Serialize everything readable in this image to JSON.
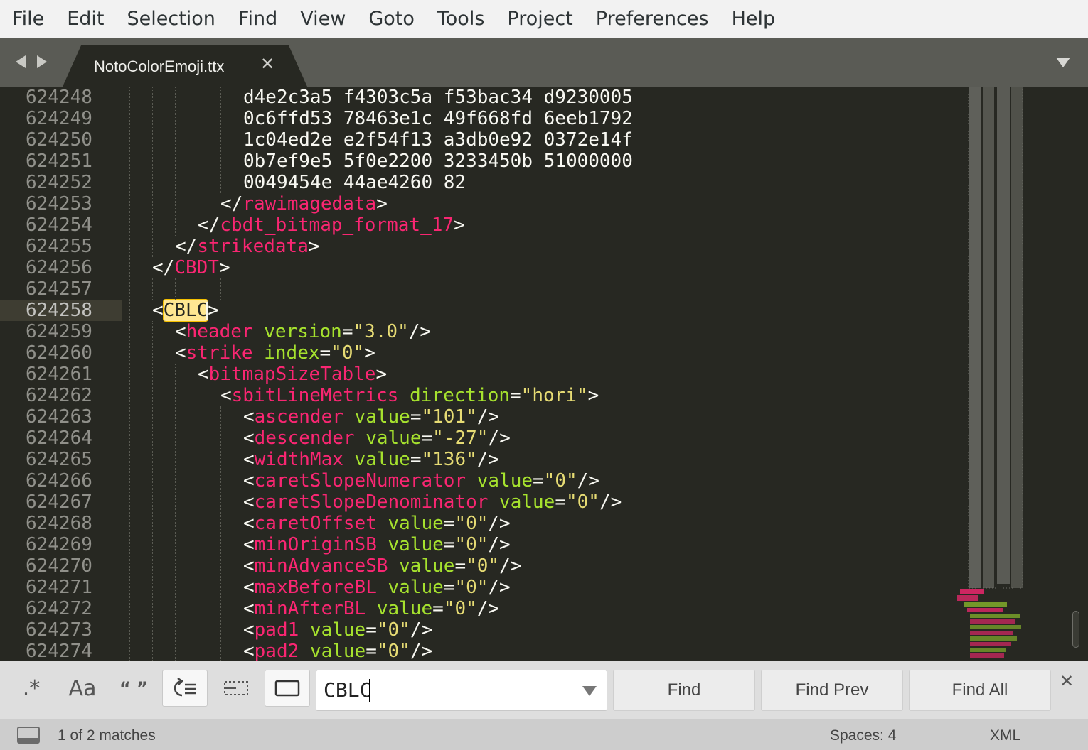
{
  "menubar": {
    "items": [
      "File",
      "Edit",
      "Selection",
      "Find",
      "View",
      "Goto",
      "Tools",
      "Project",
      "Preferences",
      "Help"
    ]
  },
  "tabbar": {
    "active_tab": {
      "label": "NotoColorEmoji.ttx",
      "close_glyph": "✕"
    }
  },
  "editor": {
    "syntax": "XML",
    "current_line": "624258",
    "lines": [
      {
        "number": "624248",
        "indent": 5,
        "tokens": [
          {
            "t": "d4e2c3a5 f4303c5a f53bac34 d9230005",
            "c": "punct"
          }
        ]
      },
      {
        "number": "624249",
        "indent": 5,
        "tokens": [
          {
            "t": "0c6ffd53 78463e1c 49f668fd 6eeb1792",
            "c": "punct"
          }
        ]
      },
      {
        "number": "624250",
        "indent": 5,
        "tokens": [
          {
            "t": "1c04ed2e e2f54f13 a3db0e92 0372e14f",
            "c": "punct"
          }
        ]
      },
      {
        "number": "624251",
        "indent": 5,
        "tokens": [
          {
            "t": "0b7ef9e5 5f0e2200 3233450b 51000000",
            "c": "punct"
          }
        ]
      },
      {
        "number": "624252",
        "indent": 5,
        "tokens": [
          {
            "t": "0049454e 44ae4260 82",
            "c": "punct"
          }
        ]
      },
      {
        "number": "624253",
        "indent": 4,
        "tokens": [
          {
            "t": "</",
            "c": "punct"
          },
          {
            "t": "rawimagedata",
            "c": "tag"
          },
          {
            "t": ">",
            "c": "punct"
          }
        ]
      },
      {
        "number": "624254",
        "indent": 3,
        "tokens": [
          {
            "t": "</",
            "c": "punct"
          },
          {
            "t": "cbdt_bitmap_format_17",
            "c": "tag"
          },
          {
            "t": ">",
            "c": "punct"
          }
        ]
      },
      {
        "number": "624255",
        "indent": 2,
        "tokens": [
          {
            "t": "</",
            "c": "punct"
          },
          {
            "t": "strikedata",
            "c": "tag"
          },
          {
            "t": ">",
            "c": "punct"
          }
        ]
      },
      {
        "number": "624256",
        "indent": 1,
        "tokens": [
          {
            "t": "</",
            "c": "punct"
          },
          {
            "t": "CBDT",
            "c": "tag"
          },
          {
            "t": ">",
            "c": "punct"
          }
        ]
      },
      {
        "number": "624257",
        "indent": 0,
        "tokens": []
      },
      {
        "number": "624258",
        "indent": 1,
        "tokens": [
          {
            "t": "<",
            "c": "punct"
          },
          {
            "t": "CBLC",
            "c": "match"
          },
          {
            "t": ">",
            "c": "punct"
          }
        ]
      },
      {
        "number": "624259",
        "indent": 2,
        "tokens": [
          {
            "t": "<",
            "c": "punct"
          },
          {
            "t": "header",
            "c": "tag"
          },
          {
            "t": " ",
            "c": "punct"
          },
          {
            "t": "version",
            "c": "attr"
          },
          {
            "t": "=",
            "c": "punct"
          },
          {
            "t": "\"3.0\"",
            "c": "str"
          },
          {
            "t": "/>",
            "c": "punct"
          }
        ]
      },
      {
        "number": "624260",
        "indent": 2,
        "tokens": [
          {
            "t": "<",
            "c": "punct"
          },
          {
            "t": "strike",
            "c": "tag"
          },
          {
            "t": " ",
            "c": "punct"
          },
          {
            "t": "index",
            "c": "attr"
          },
          {
            "t": "=",
            "c": "punct"
          },
          {
            "t": "\"0\"",
            "c": "str"
          },
          {
            "t": ">",
            "c": "punct"
          }
        ]
      },
      {
        "number": "624261",
        "indent": 3,
        "tokens": [
          {
            "t": "<",
            "c": "punct"
          },
          {
            "t": "bitmapSizeTable",
            "c": "tag"
          },
          {
            "t": ">",
            "c": "punct"
          }
        ]
      },
      {
        "number": "624262",
        "indent": 4,
        "tokens": [
          {
            "t": "<",
            "c": "punct"
          },
          {
            "t": "sbitLineMetrics",
            "c": "tag"
          },
          {
            "t": " ",
            "c": "punct"
          },
          {
            "t": "direction",
            "c": "attr"
          },
          {
            "t": "=",
            "c": "punct"
          },
          {
            "t": "\"hori\"",
            "c": "str"
          },
          {
            "t": ">",
            "c": "punct"
          }
        ]
      },
      {
        "number": "624263",
        "indent": 5,
        "tokens": [
          {
            "t": "<",
            "c": "punct"
          },
          {
            "t": "ascender",
            "c": "tag"
          },
          {
            "t": " ",
            "c": "punct"
          },
          {
            "t": "value",
            "c": "attr"
          },
          {
            "t": "=",
            "c": "punct"
          },
          {
            "t": "\"101\"",
            "c": "str"
          },
          {
            "t": "/>",
            "c": "punct"
          }
        ]
      },
      {
        "number": "624264",
        "indent": 5,
        "tokens": [
          {
            "t": "<",
            "c": "punct"
          },
          {
            "t": "descender",
            "c": "tag"
          },
          {
            "t": " ",
            "c": "punct"
          },
          {
            "t": "value",
            "c": "attr"
          },
          {
            "t": "=",
            "c": "punct"
          },
          {
            "t": "\"-27\"",
            "c": "str"
          },
          {
            "t": "/>",
            "c": "punct"
          }
        ]
      },
      {
        "number": "624265",
        "indent": 5,
        "tokens": [
          {
            "t": "<",
            "c": "punct"
          },
          {
            "t": "widthMax",
            "c": "tag"
          },
          {
            "t": " ",
            "c": "punct"
          },
          {
            "t": "value",
            "c": "attr"
          },
          {
            "t": "=",
            "c": "punct"
          },
          {
            "t": "\"136\"",
            "c": "str"
          },
          {
            "t": "/>",
            "c": "punct"
          }
        ]
      },
      {
        "number": "624266",
        "indent": 5,
        "tokens": [
          {
            "t": "<",
            "c": "punct"
          },
          {
            "t": "caretSlopeNumerator",
            "c": "tag"
          },
          {
            "t": " ",
            "c": "punct"
          },
          {
            "t": "value",
            "c": "attr"
          },
          {
            "t": "=",
            "c": "punct"
          },
          {
            "t": "\"0\"",
            "c": "str"
          },
          {
            "t": "/>",
            "c": "punct"
          }
        ]
      },
      {
        "number": "624267",
        "indent": 5,
        "tokens": [
          {
            "t": "<",
            "c": "punct"
          },
          {
            "t": "caretSlopeDenominator",
            "c": "tag"
          },
          {
            "t": " ",
            "c": "punct"
          },
          {
            "t": "value",
            "c": "attr"
          },
          {
            "t": "=",
            "c": "punct"
          },
          {
            "t": "\"0\"",
            "c": "str"
          },
          {
            "t": "/>",
            "c": "punct"
          }
        ]
      },
      {
        "number": "624268",
        "indent": 5,
        "tokens": [
          {
            "t": "<",
            "c": "punct"
          },
          {
            "t": "caretOffset",
            "c": "tag"
          },
          {
            "t": " ",
            "c": "punct"
          },
          {
            "t": "value",
            "c": "attr"
          },
          {
            "t": "=",
            "c": "punct"
          },
          {
            "t": "\"0\"",
            "c": "str"
          },
          {
            "t": "/>",
            "c": "punct"
          }
        ]
      },
      {
        "number": "624269",
        "indent": 5,
        "tokens": [
          {
            "t": "<",
            "c": "punct"
          },
          {
            "t": "minOriginSB",
            "c": "tag"
          },
          {
            "t": " ",
            "c": "punct"
          },
          {
            "t": "value",
            "c": "attr"
          },
          {
            "t": "=",
            "c": "punct"
          },
          {
            "t": "\"0\"",
            "c": "str"
          },
          {
            "t": "/>",
            "c": "punct"
          }
        ]
      },
      {
        "number": "624270",
        "indent": 5,
        "tokens": [
          {
            "t": "<",
            "c": "punct"
          },
          {
            "t": "minAdvanceSB",
            "c": "tag"
          },
          {
            "t": " ",
            "c": "punct"
          },
          {
            "t": "value",
            "c": "attr"
          },
          {
            "t": "=",
            "c": "punct"
          },
          {
            "t": "\"0\"",
            "c": "str"
          },
          {
            "t": "/>",
            "c": "punct"
          }
        ]
      },
      {
        "number": "624271",
        "indent": 5,
        "tokens": [
          {
            "t": "<",
            "c": "punct"
          },
          {
            "t": "maxBeforeBL",
            "c": "tag"
          },
          {
            "t": " ",
            "c": "punct"
          },
          {
            "t": "value",
            "c": "attr"
          },
          {
            "t": "=",
            "c": "punct"
          },
          {
            "t": "\"0\"",
            "c": "str"
          },
          {
            "t": "/>",
            "c": "punct"
          }
        ]
      },
      {
        "number": "624272",
        "indent": 5,
        "tokens": [
          {
            "t": "<",
            "c": "punct"
          },
          {
            "t": "minAfterBL",
            "c": "tag"
          },
          {
            "t": " ",
            "c": "punct"
          },
          {
            "t": "value",
            "c": "attr"
          },
          {
            "t": "=",
            "c": "punct"
          },
          {
            "t": "\"0\"",
            "c": "str"
          },
          {
            "t": "/>",
            "c": "punct"
          }
        ]
      },
      {
        "number": "624273",
        "indent": 5,
        "tokens": [
          {
            "t": "<",
            "c": "punct"
          },
          {
            "t": "pad1",
            "c": "tag"
          },
          {
            "t": " ",
            "c": "punct"
          },
          {
            "t": "value",
            "c": "attr"
          },
          {
            "t": "=",
            "c": "punct"
          },
          {
            "t": "\"0\"",
            "c": "str"
          },
          {
            "t": "/>",
            "c": "punct"
          }
        ]
      },
      {
        "number": "624274",
        "indent": 5,
        "tokens": [
          {
            "t": "<",
            "c": "punct"
          },
          {
            "t": "pad2",
            "c": "tag"
          },
          {
            "t": " ",
            "c": "punct"
          },
          {
            "t": "value",
            "c": "attr"
          },
          {
            "t": "=",
            "c": "punct"
          },
          {
            "t": "\"0\"",
            "c": "str"
          },
          {
            "t": "/>",
            "c": "punct"
          }
        ]
      }
    ]
  },
  "findpanel": {
    "options": [
      {
        "name": "regex-toggle",
        "glyph": ".*",
        "active": false
      },
      {
        "name": "case-sensitive-toggle",
        "glyph": "Aa",
        "active": false
      },
      {
        "name": "whole-word-toggle",
        "glyph": "“ ”",
        "active": false
      },
      {
        "name": "wrap-toggle",
        "glyph": "wrap-icon",
        "active": true
      },
      {
        "name": "in-selection-toggle",
        "glyph": "selection-icon",
        "active": false
      },
      {
        "name": "highlight-matches-toggle",
        "glyph": "highlight-icon",
        "active": true
      }
    ],
    "query": "CBLC",
    "find_label": "Find",
    "find_prev_label": "Find Prev",
    "find_all_label": "Find All",
    "close_glyph": "✕"
  },
  "statusbar": {
    "matches": "1 of 2 matches",
    "indentation": "Spaces: 4",
    "syntax": "XML"
  },
  "colors": {
    "background": "#272822",
    "tag": "#f92672",
    "attribute": "#a6e22e",
    "string": "#e6db74",
    "text": "#f8f8f2",
    "line_number": "#90908a",
    "match_highlight": "#ffe792"
  }
}
